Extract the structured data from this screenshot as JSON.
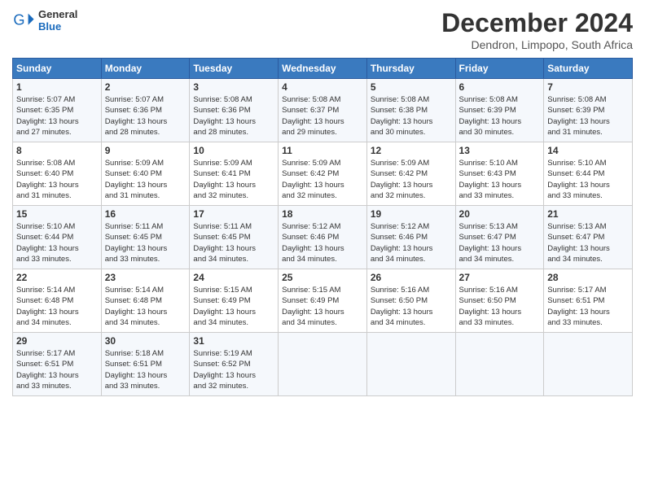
{
  "logo": {
    "line1": "General",
    "line2": "Blue",
    "icon": "🔵"
  },
  "title": "December 2024",
  "location": "Dendron, Limpopo, South Africa",
  "headers": [
    "Sunday",
    "Monday",
    "Tuesday",
    "Wednesday",
    "Thursday",
    "Friday",
    "Saturday"
  ],
  "weeks": [
    [
      {
        "day": "1",
        "info": "Sunrise: 5:07 AM\nSunset: 6:35 PM\nDaylight: 13 hours\nand 27 minutes."
      },
      {
        "day": "2",
        "info": "Sunrise: 5:07 AM\nSunset: 6:36 PM\nDaylight: 13 hours\nand 28 minutes."
      },
      {
        "day": "3",
        "info": "Sunrise: 5:08 AM\nSunset: 6:36 PM\nDaylight: 13 hours\nand 28 minutes."
      },
      {
        "day": "4",
        "info": "Sunrise: 5:08 AM\nSunset: 6:37 PM\nDaylight: 13 hours\nand 29 minutes."
      },
      {
        "day": "5",
        "info": "Sunrise: 5:08 AM\nSunset: 6:38 PM\nDaylight: 13 hours\nand 30 minutes."
      },
      {
        "day": "6",
        "info": "Sunrise: 5:08 AM\nSunset: 6:39 PM\nDaylight: 13 hours\nand 30 minutes."
      },
      {
        "day": "7",
        "info": "Sunrise: 5:08 AM\nSunset: 6:39 PM\nDaylight: 13 hours\nand 31 minutes."
      }
    ],
    [
      {
        "day": "8",
        "info": "Sunrise: 5:08 AM\nSunset: 6:40 PM\nDaylight: 13 hours\nand 31 minutes."
      },
      {
        "day": "9",
        "info": "Sunrise: 5:09 AM\nSunset: 6:40 PM\nDaylight: 13 hours\nand 31 minutes."
      },
      {
        "day": "10",
        "info": "Sunrise: 5:09 AM\nSunset: 6:41 PM\nDaylight: 13 hours\nand 32 minutes."
      },
      {
        "day": "11",
        "info": "Sunrise: 5:09 AM\nSunset: 6:42 PM\nDaylight: 13 hours\nand 32 minutes."
      },
      {
        "day": "12",
        "info": "Sunrise: 5:09 AM\nSunset: 6:42 PM\nDaylight: 13 hours\nand 32 minutes."
      },
      {
        "day": "13",
        "info": "Sunrise: 5:10 AM\nSunset: 6:43 PM\nDaylight: 13 hours\nand 33 minutes."
      },
      {
        "day": "14",
        "info": "Sunrise: 5:10 AM\nSunset: 6:44 PM\nDaylight: 13 hours\nand 33 minutes."
      }
    ],
    [
      {
        "day": "15",
        "info": "Sunrise: 5:10 AM\nSunset: 6:44 PM\nDaylight: 13 hours\nand 33 minutes."
      },
      {
        "day": "16",
        "info": "Sunrise: 5:11 AM\nSunset: 6:45 PM\nDaylight: 13 hours\nand 33 minutes."
      },
      {
        "day": "17",
        "info": "Sunrise: 5:11 AM\nSunset: 6:45 PM\nDaylight: 13 hours\nand 34 minutes."
      },
      {
        "day": "18",
        "info": "Sunrise: 5:12 AM\nSunset: 6:46 PM\nDaylight: 13 hours\nand 34 minutes."
      },
      {
        "day": "19",
        "info": "Sunrise: 5:12 AM\nSunset: 6:46 PM\nDaylight: 13 hours\nand 34 minutes."
      },
      {
        "day": "20",
        "info": "Sunrise: 5:13 AM\nSunset: 6:47 PM\nDaylight: 13 hours\nand 34 minutes."
      },
      {
        "day": "21",
        "info": "Sunrise: 5:13 AM\nSunset: 6:47 PM\nDaylight: 13 hours\nand 34 minutes."
      }
    ],
    [
      {
        "day": "22",
        "info": "Sunrise: 5:14 AM\nSunset: 6:48 PM\nDaylight: 13 hours\nand 34 minutes."
      },
      {
        "day": "23",
        "info": "Sunrise: 5:14 AM\nSunset: 6:48 PM\nDaylight: 13 hours\nand 34 minutes."
      },
      {
        "day": "24",
        "info": "Sunrise: 5:15 AM\nSunset: 6:49 PM\nDaylight: 13 hours\nand 34 minutes."
      },
      {
        "day": "25",
        "info": "Sunrise: 5:15 AM\nSunset: 6:49 PM\nDaylight: 13 hours\nand 34 minutes."
      },
      {
        "day": "26",
        "info": "Sunrise: 5:16 AM\nSunset: 6:50 PM\nDaylight: 13 hours\nand 34 minutes."
      },
      {
        "day": "27",
        "info": "Sunrise: 5:16 AM\nSunset: 6:50 PM\nDaylight: 13 hours\nand 33 minutes."
      },
      {
        "day": "28",
        "info": "Sunrise: 5:17 AM\nSunset: 6:51 PM\nDaylight: 13 hours\nand 33 minutes."
      }
    ],
    [
      {
        "day": "29",
        "info": "Sunrise: 5:17 AM\nSunset: 6:51 PM\nDaylight: 13 hours\nand 33 minutes."
      },
      {
        "day": "30",
        "info": "Sunrise: 5:18 AM\nSunset: 6:51 PM\nDaylight: 13 hours\nand 33 minutes."
      },
      {
        "day": "31",
        "info": "Sunrise: 5:19 AM\nSunset: 6:52 PM\nDaylight: 13 hours\nand 32 minutes."
      },
      {
        "day": "",
        "info": ""
      },
      {
        "day": "",
        "info": ""
      },
      {
        "day": "",
        "info": ""
      },
      {
        "day": "",
        "info": ""
      }
    ]
  ]
}
